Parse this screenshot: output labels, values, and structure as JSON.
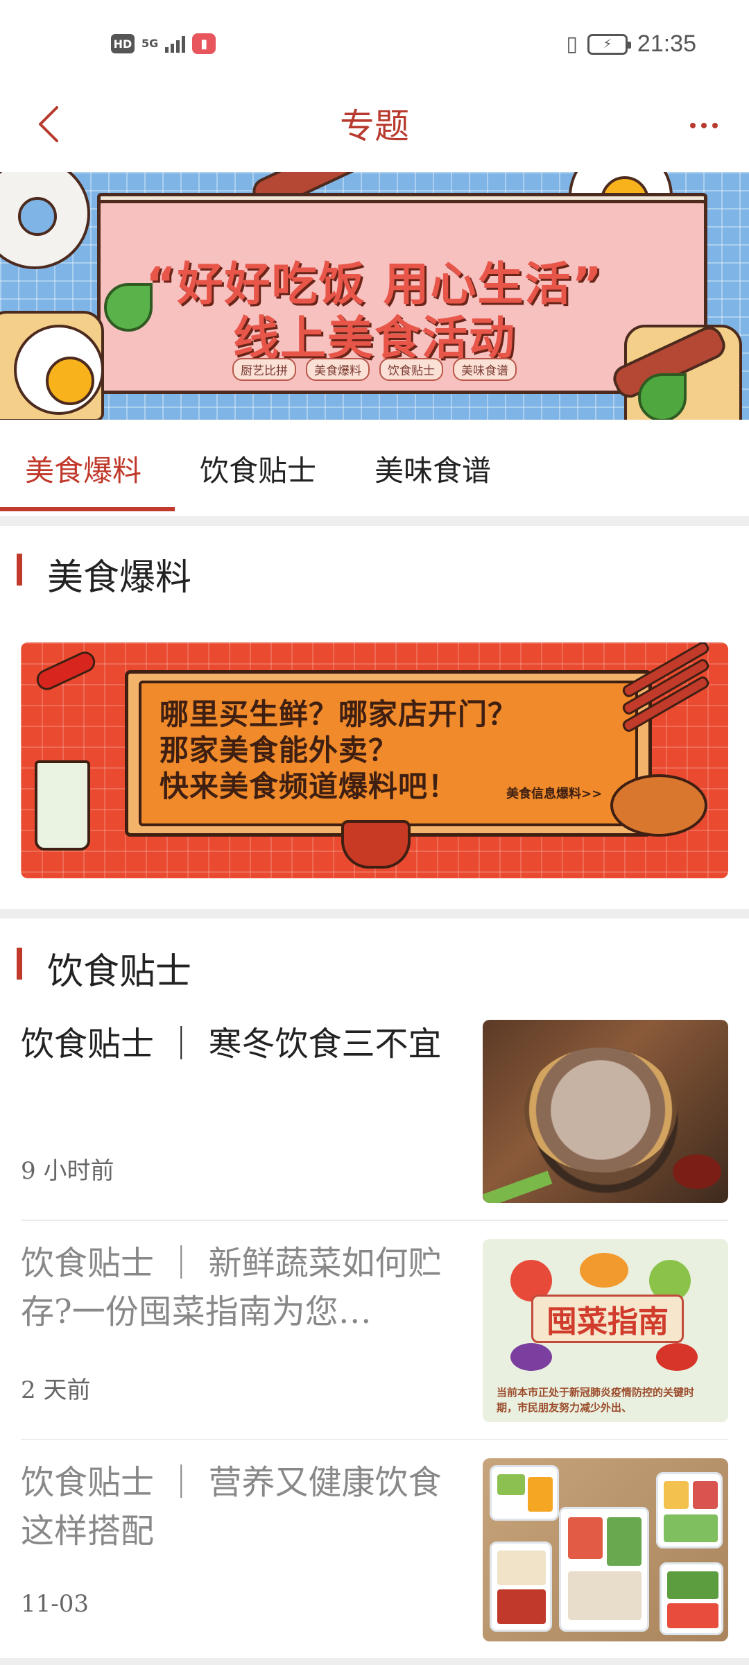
{
  "status_bar": {
    "left_icons": [
      "hd-icon",
      "5g-signal-icon",
      "book-app-icon"
    ],
    "hd_label": "HD",
    "network_label": "5G",
    "time": "21:35"
  },
  "nav": {
    "title": "专题"
  },
  "banner": {
    "headline_line1": "“好好吃饭 用心生活”",
    "headline_line2": "线上美食活动",
    "tags": [
      "厨艺比拼",
      "美食爆料",
      "饮食贴士",
      "美味食谱"
    ]
  },
  "tabs": [
    {
      "label": "美食爆料",
      "active": true
    },
    {
      "label": "饮食贴士",
      "active": false
    },
    {
      "label": "美味食谱",
      "active": false
    }
  ],
  "section_food_news": {
    "title": "美食爆料",
    "promo": {
      "line1": "哪里买生鲜？哪家店开门？",
      "line2": "那家美食能外卖？",
      "line3": "快来美食频道爆料吧！",
      "link": "美食信息爆料>>"
    }
  },
  "section_diet_tips": {
    "title": "饮食贴士",
    "articles": [
      {
        "title": "饮食贴士 ｜ 寒冬饮食三不宜",
        "time": "9 小时前",
        "read": false
      },
      {
        "title": "饮食贴士 ｜ 新鲜蔬菜如何贮存?一份囤菜指南为您…",
        "time": "2 天前",
        "read": true,
        "thumb_title": "囤菜指南",
        "thumb_caption": "当前本市正处于新冠肺炎疫情防控的关键时期，市民朋友努力减少外出、"
      },
      {
        "title": "饮食贴士 ｜ 营养又健康饮食这样搭配",
        "time": "11-03",
        "read": true
      }
    ]
  },
  "colors": {
    "accent": "#c0392b",
    "banner_bg": "#7fb5e6",
    "promo_bg": "#ea4a30"
  }
}
